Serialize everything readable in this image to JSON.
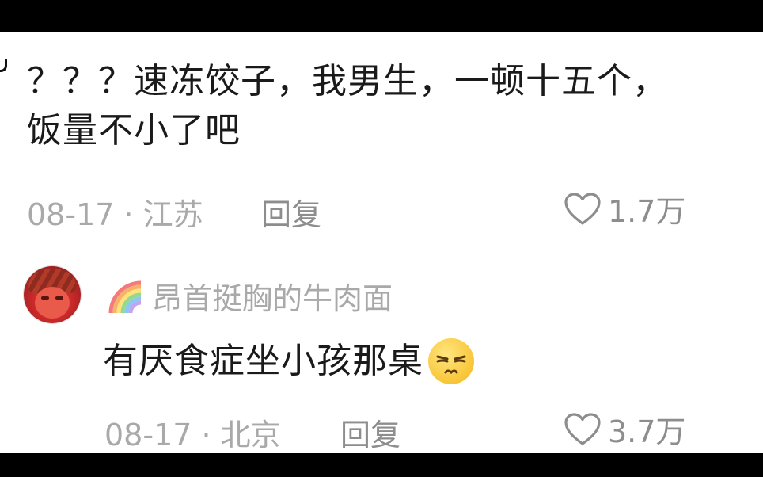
{
  "comment1": {
    "line1": "？？？速冻饺子，我男生，一顿十五个，",
    "line2": "饭量不小了吧",
    "date_location": "08-17 · 江苏",
    "reply_label": "回复",
    "likes": "1.7万"
  },
  "comment2": {
    "username": "昂首挺胸的牛肉面",
    "text": "有厌食症坐小孩那桌",
    "emoji_icon": "squinting-annoyed-face-emoji",
    "date_location": "08-17 · 北京",
    "reply_label": "回复",
    "likes": "3.7万"
  },
  "colors": {
    "text": "#1a1a1a",
    "meta": "#a9a9a9",
    "action": "#8d8d8d",
    "letterbox": "#000000"
  }
}
